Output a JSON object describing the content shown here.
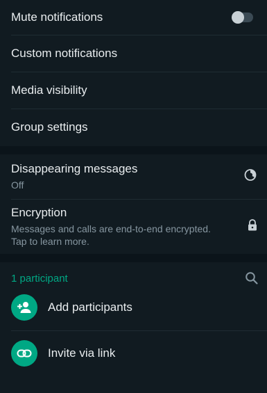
{
  "notifications": {
    "mute_label": "Mute notifications",
    "mute_on": false,
    "custom_label": "Custom notifications",
    "media_label": "Media visibility",
    "group_label": "Group settings"
  },
  "privacy": {
    "disappearing_label": "Disappearing messages",
    "disappearing_value": "Off",
    "encryption_label": "Encryption",
    "encryption_line1": "Messages and calls are end-to-end encrypted.",
    "encryption_line2": "Tap to learn more."
  },
  "participants": {
    "count_label": "1 participant",
    "add_label": "Add participants",
    "invite_label": "Invite via link"
  },
  "colors": {
    "background": "#111b21",
    "accent": "#00a884",
    "text": "#e9edef",
    "secondary_text": "#8696a0"
  },
  "icons": [
    "toggle-switch",
    "timer-icon",
    "lock-icon",
    "search-icon",
    "add-person-icon",
    "link-icon"
  ]
}
